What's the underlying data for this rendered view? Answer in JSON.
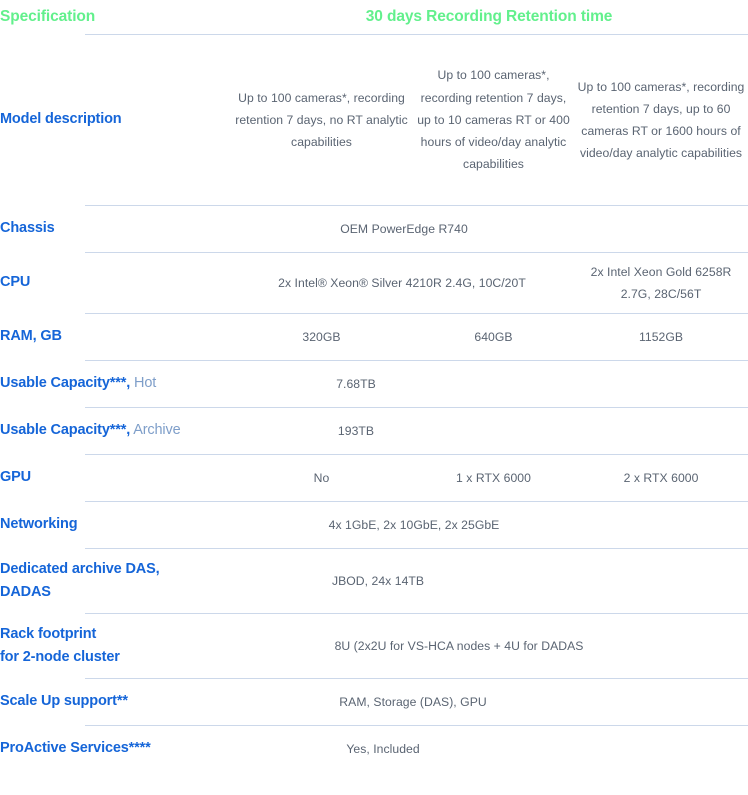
{
  "header": {
    "spec_label": "Specification",
    "retention_label": "30 days Recording Retention time",
    "green": "#62f08c",
    "blue": "#1565d8"
  },
  "columns": [
    "col-1",
    "col-2",
    "col-3"
  ],
  "rows": {
    "model_description": {
      "label": "Model description",
      "col1": "Up to 100 cameras*, recording retention 7 days, no RT analytic capabilities",
      "col2": "Up to 100 cameras*, recording retention 7 days, up to 10 cameras RT or 400 hours of video/day analytic capabilities",
      "col3": "Up to 100 cameras*, recording retention 7 days, up to 60 cameras RT or 1600 hours of video/day analytic capabilities"
    },
    "chassis": {
      "label": "Chassis",
      "value": "OEM PowerEdge R740"
    },
    "cpu": {
      "label": "CPU",
      "col12": "2x Intel® Xeon® Silver 4210R 2.4G, 10C/20T",
      "col3": "2x Intel Xeon Gold 6258R 2.7G, 28C/56T"
    },
    "ram": {
      "label": "RAM, GB",
      "col1": "320GB",
      "col2": "640GB",
      "col3": "1152GB"
    },
    "usable_hot": {
      "label_bold": "Usable Capacity***,",
      "label_sub": " Hot",
      "value": "7.68TB"
    },
    "usable_archive": {
      "label_bold": "Usable Capacity***,",
      "label_sub": " Archive",
      "value": "193TB"
    },
    "gpu": {
      "label": "GPU",
      "col1": "No",
      "col2": "1 x RTX 6000",
      "col3": "2 x RTX 6000"
    },
    "networking": {
      "label": "Networking",
      "value": "4x 1GbE, 2x 10GbE, 2x 25GbE"
    },
    "dadas": {
      "label_line1": "Dedicated archive DAS,",
      "label_line2": "DADAS",
      "value": "JBOD, 24x 14TB"
    },
    "rack_footprint": {
      "label_line1": "Rack footprint",
      "label_line2": "for 2-node cluster",
      "value": "8U (2x2U for VS-HCA nodes + 4U for DADAS"
    },
    "scale_up": {
      "label": "Scale Up support**",
      "value": "RAM, Storage (DAS), GPU"
    },
    "proactive": {
      "label": "ProActive Services****",
      "value": "Yes, Included"
    }
  }
}
